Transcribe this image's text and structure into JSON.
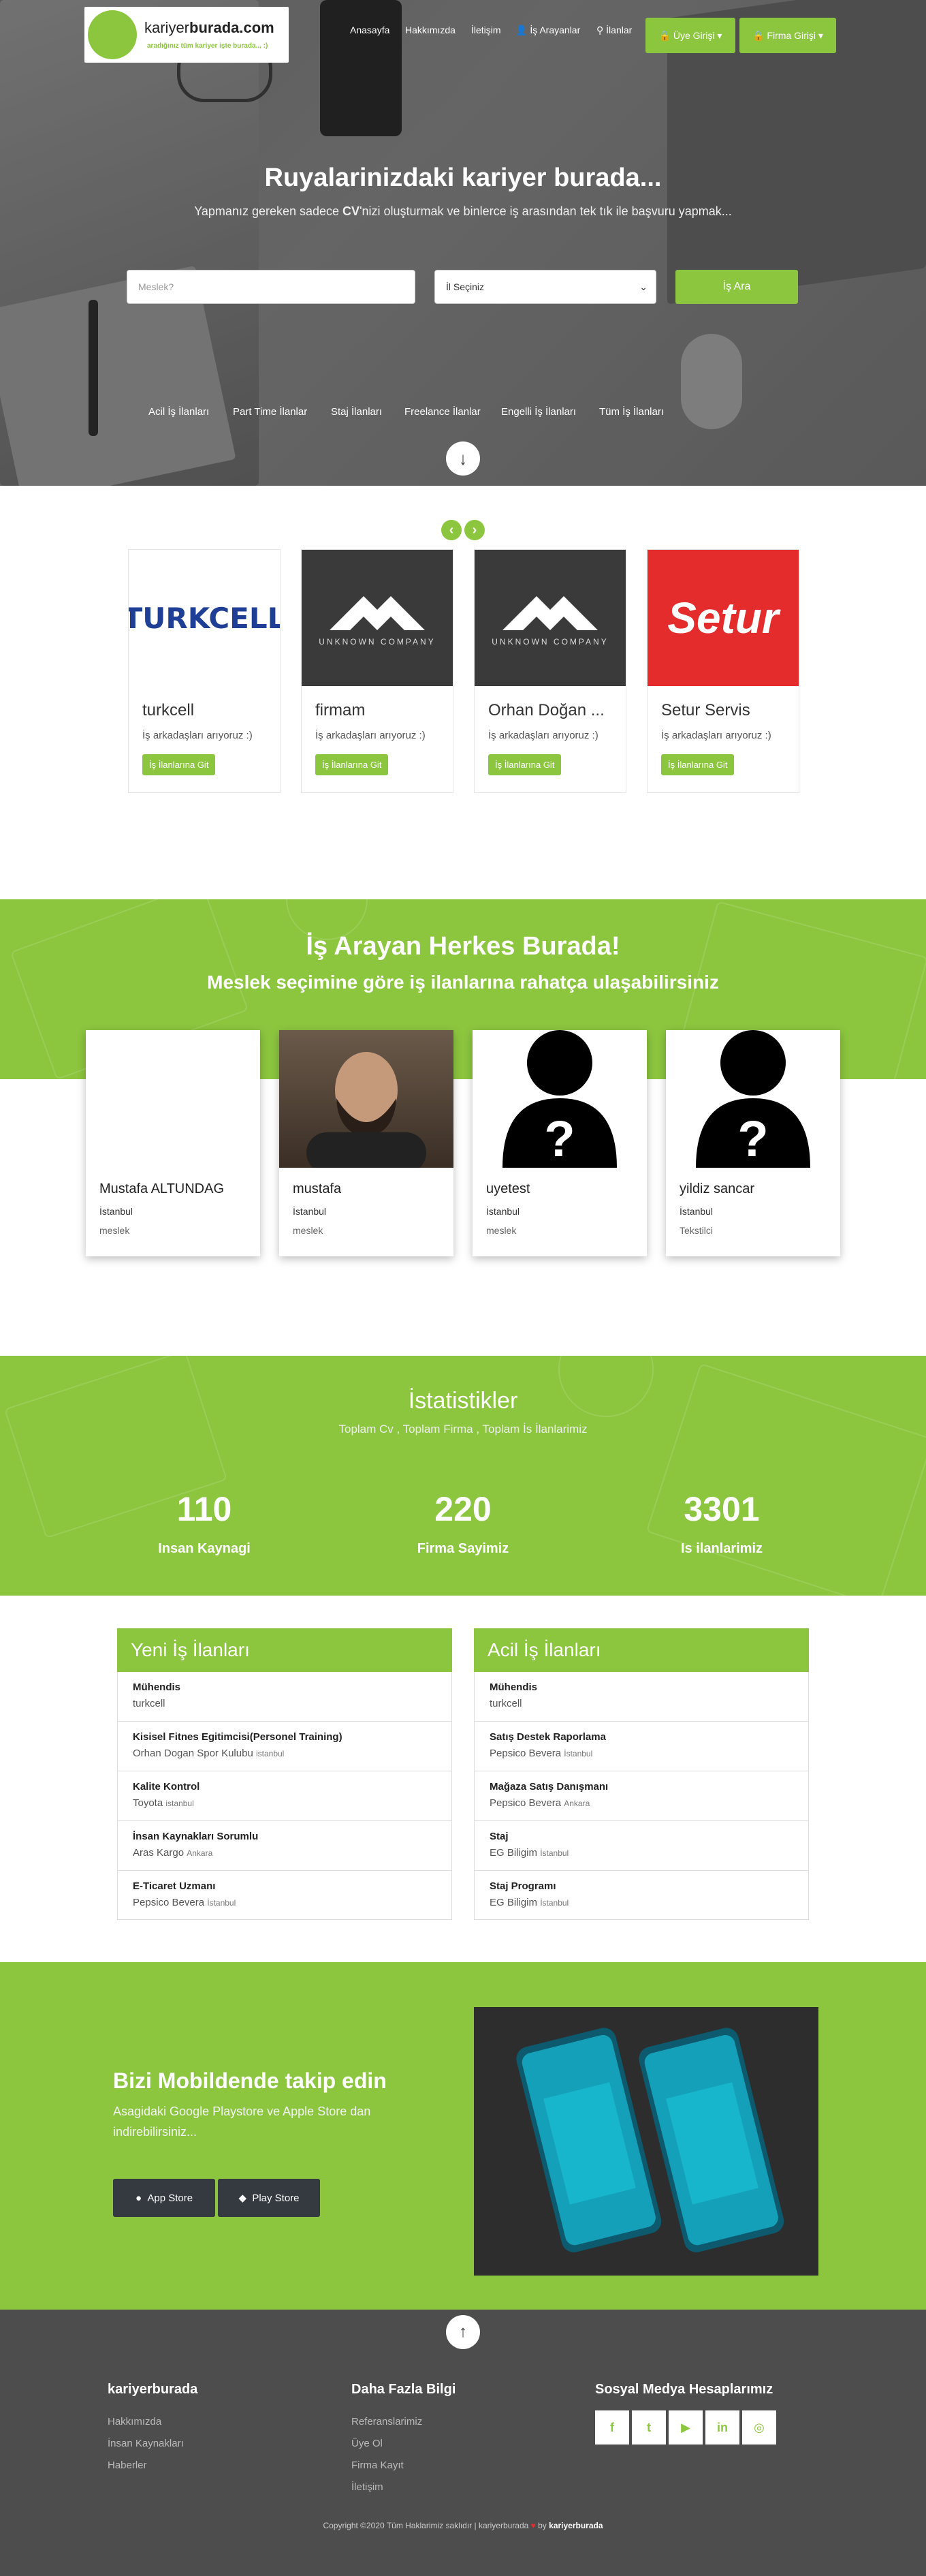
{
  "header": {
    "logo_name_light": "kariyer",
    "logo_name_bold": "burada.com",
    "logo_tagline": "aradığınız tüm kariyer işte burada... :)",
    "nav": [
      "Anasayfa",
      "Hakkımızda",
      "İletişim",
      "İş Arayanlar",
      "İlanlar"
    ],
    "member_login": "Üye Girişi",
    "company_login": "Firma Girişi"
  },
  "hero": {
    "title": "Ruyalarinizdaki kariyer burada...",
    "subtitle_pre": "Yapmanız gereken sadece ",
    "subtitle_bold": "CV",
    "subtitle_post": "'nizi oluşturmak ve binlerce iş arasından tek tık ile başvuru yapmak...",
    "job_placeholder": "Meslek?",
    "city_select": "İl Seçiniz",
    "search_button": "İş Ara",
    "quick_links": [
      "Acil İş İlanları",
      "Part Time İlanlar",
      "Staj İlanları",
      "Freelance İlanlar",
      "Engelli İş İlanları",
      "Tüm İş İlanları"
    ]
  },
  "companies": [
    {
      "name": "turkcell",
      "desc": "İş arkadaşları arıyoruz :)",
      "button": "İş İlanlarına Git",
      "logo_text": "TURKCELL"
    },
    {
      "name": "firmam",
      "desc": "İş arkadaşları arıyoruz :)",
      "button": "İş İlanlarına Git",
      "logo_text": "UNKNOWN COMPANY"
    },
    {
      "name": "Orhan Doğan ...",
      "desc": "İş arkadaşları arıyoruz :)",
      "button": "İş İlanlarına Git",
      "logo_text": "UNKNOWN COMPANY"
    },
    {
      "name": "Setur Servis",
      "desc": "İş arkadaşları arıyoruz :)",
      "button": "İş İlanlarına Git",
      "logo_text": "Setur"
    }
  ],
  "seekers": {
    "title": "İş Arayan Herkes Burada!",
    "subtitle": "Meslek seçimine göre iş ilanlarına rahatça ulaşabilirsiniz",
    "people": [
      {
        "name": "Mustafa ALTUNDAG",
        "city": "İstanbul",
        "job": "meslek"
      },
      {
        "name": "mustafa",
        "city": "İstanbul",
        "job": "meslek"
      },
      {
        "name": "uyetest",
        "city": "İstanbul",
        "job": "meslek"
      },
      {
        "name": "yildiz sancar",
        "city": "İstanbul",
        "job": "Tekstilci"
      }
    ]
  },
  "stats": {
    "title": "İstatistikler",
    "subtitle": "Toplam Cv , Toplam Firma , Toplam İs İlanlarimiz",
    "items": [
      {
        "value": "110",
        "label": "Insan Kaynagi"
      },
      {
        "value": "220",
        "label": "Firma Sayimiz"
      },
      {
        "value": "3301",
        "label": "Is ilanlarimiz"
      }
    ]
  },
  "new_jobs": {
    "title": "Yeni İş İlanları",
    "items": [
      {
        "title": "Mühendis",
        "company": "turkcell",
        "city": ""
      },
      {
        "title": "Kisisel Fitnes Egitimcisi(Personel Training)",
        "company": "Orhan Dogan Spor Kulubu",
        "city": "istanbul"
      },
      {
        "title": "Kalite Kontrol",
        "company": "Toyota",
        "city": "istanbul"
      },
      {
        "title": "İnsan Kaynakları Sorumlu",
        "company": "Aras Kargo",
        "city": "Ankara"
      },
      {
        "title": "E-Ticaret Uzmanı",
        "company": "Pepsico Bevera",
        "city": "İstanbul"
      }
    ]
  },
  "urgent_jobs": {
    "title": "Acil İş İlanları",
    "items": [
      {
        "title": "Mühendis",
        "company": "turkcell",
        "city": ""
      },
      {
        "title": "Satış Destek Raporlama",
        "company": "Pepsico Bevera",
        "city": "İstanbul"
      },
      {
        "title": "Mağaza Satış Danışmanı",
        "company": "Pepsico Bevera",
        "city": "Ankara"
      },
      {
        "title": "Staj",
        "company": "EG Biligim",
        "city": "İstanbul"
      },
      {
        "title": "Staj Programı",
        "company": "EG Biligim",
        "city": "İstanbul"
      }
    ]
  },
  "mobile": {
    "title": "Bizi Mobildende takip edin",
    "subtitle": "Asagidaki Google Playstore ve Apple Store dan indirebilirsiniz...",
    "app_store": "App Store",
    "play_store": "Play Store"
  },
  "footer": {
    "col1_title": "kariyerburada",
    "col1_links": [
      "Hakkımızda",
      "İnsan Kaynakları",
      "Haberler"
    ],
    "col2_title": "Daha Fazla Bilgi",
    "col2_links": [
      "Referanslarimiz",
      "Üye Ol",
      "Firma Kayıt",
      "İletişim"
    ],
    "col3_title": "Sosyal Medya Hesaplarımız",
    "social": [
      "f",
      "t",
      "▶",
      "in",
      "◎"
    ],
    "copyright_pre": "Copyright ©2020 Tüm Haklarimiz saklıdır | kariyerburada",
    "copyright_by": " by ",
    "copyright_brand": "kariyerburada"
  },
  "colors": {
    "accent": "#8cc63f",
    "footer": "#4d4d4d",
    "dark_button": "#343a40"
  }
}
